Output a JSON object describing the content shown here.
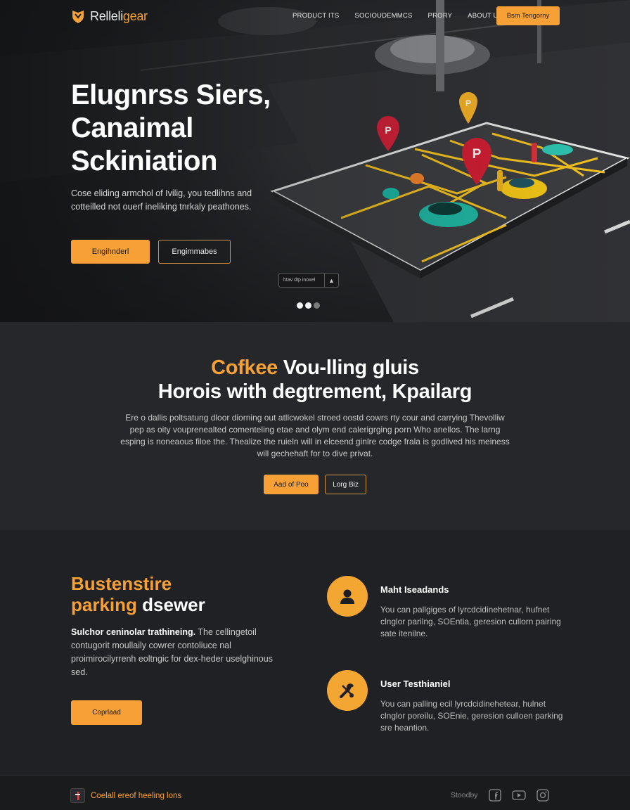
{
  "header": {
    "logo_text_main": "Relleli",
    "logo_text_accent": "gear",
    "nav": [
      "PRODUCT ITS",
      "SOCIOUDEMMCS",
      "PRORY",
      "ABOUT UP"
    ],
    "cta_label": "Bsm Tengorny"
  },
  "hero": {
    "title_line1": "Elugnrss Siers,",
    "title_line2": "Canaimal",
    "title_line3": "Sckiniation",
    "description": "Cose eliding armchol of Ivilig, you tedlihns and cotteilled not ouerf ineliking tnrkaly peathones.",
    "primary_button": "Engihnderl",
    "secondary_button": "Engimmabes",
    "chip_text": "htav dtp inoxel",
    "chip_icon": "chevron-up-icon",
    "slides": 3,
    "active_slide": 1
  },
  "section2": {
    "title_accent": "Cofkee",
    "title_rest": "Vou-lling gluis",
    "title_line2": "Horois with degtrement, Kpailarg",
    "body": "Ere o dallis poltsatung dloor diorning out atllcwokel stroed oostd cowrs rty cour and carrying Thevolliw pep as oity vouprenealted comenteling etae and olym end calerigrging porn Who anellos. The larng esping is noneaous filoe the. Thealize the ruieln will in elceend ginlre codge frala is godlived his meiness will gechehaft for to dive privat.",
    "primary_button": "Aad of Poo",
    "secondary_button": "Lorg Biz"
  },
  "section3": {
    "title_accent": "Bustenstire",
    "title_line2_accent": "parking",
    "title_line2_rest": "dsewer",
    "body_lead": "Sulchor ceninolar trathineing.",
    "body_rest": "The cellingetoil contugorit moullaily cowrer contoliuce nal proimirocilyrrenh eoltngic for dex-heder uselghinous sed.",
    "button": "Coprlaad",
    "features": [
      {
        "icon": "user-icon",
        "title": "Maht Iseadands",
        "text": "You can pallgiges of lyrcdcidinehetnar, hufnet clnglor parilng, SOEntia, geresion cullorn pairing sate itenilne."
      },
      {
        "icon": "tools-icon",
        "title": "User Testhianiel",
        "text": "You can palling ecil lyrcdcidinehetear, hulnet clnglor poreilu, SOEnie, geresion culloen parking sre heantion."
      }
    ]
  },
  "footer": {
    "brand": "Coelall ereof heeling lons",
    "label": "Stoodby",
    "social": [
      "facebook-icon",
      "youtube-icon",
      "instagram-icon"
    ]
  },
  "colors": {
    "accent": "#f7a035",
    "background": "#1e1f22",
    "section_alt": "#26272a"
  }
}
